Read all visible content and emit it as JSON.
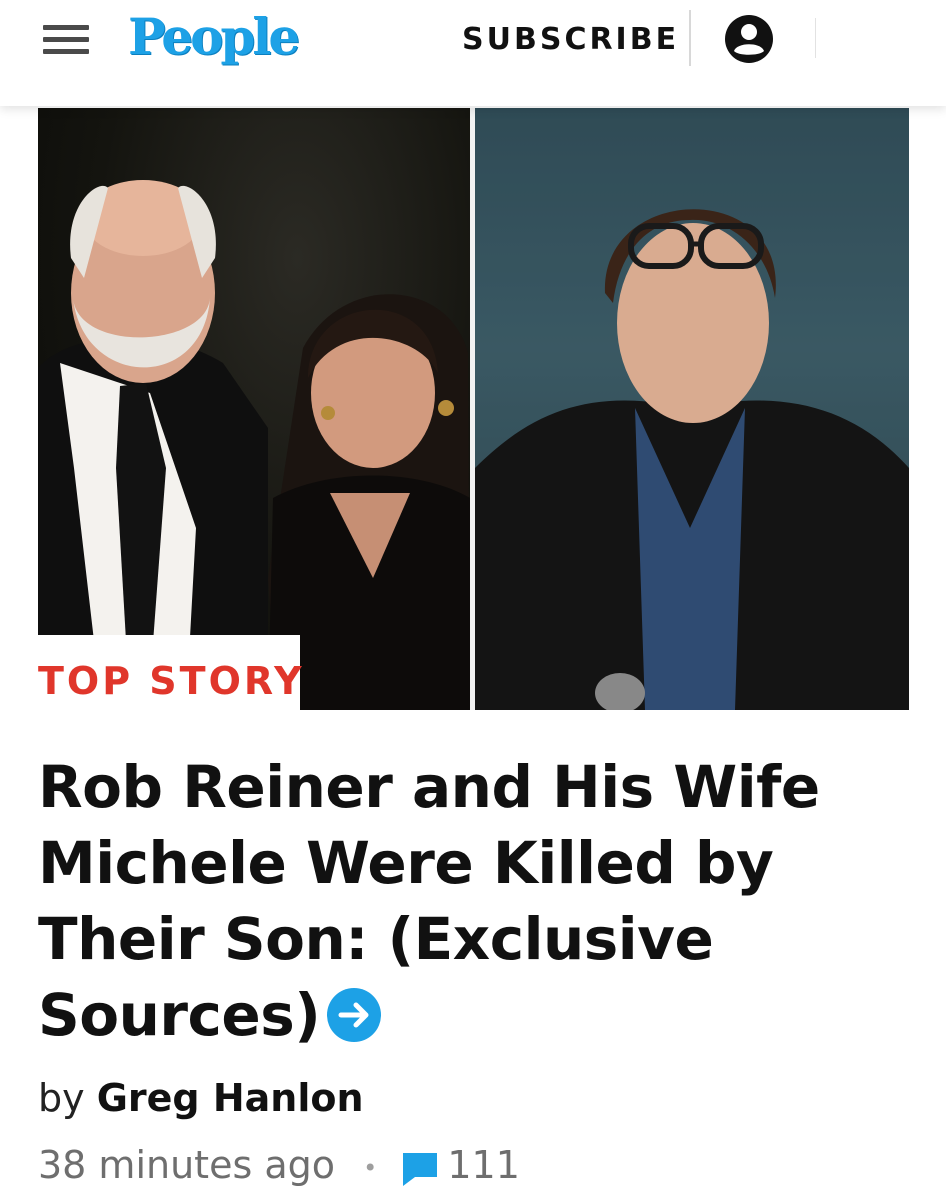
{
  "header": {
    "logo_text": "People",
    "subscribe_label": "SUBSCRIBE",
    "brand_color": "#1da1e6",
    "menu_icon": "hamburger-menu-icon",
    "account_icon": "account-circle-icon"
  },
  "hero": {
    "badge_label": "TOP STORY",
    "badge_color": "#e0362b"
  },
  "article": {
    "headline": "Rob Reiner and His Wife Michele Were Killed by Their Son: (Exclusive Sources)",
    "headline_icon": "arrow-right-circle-icon",
    "byline_prefix": "by",
    "author": "Greg Hanlon",
    "timestamp": "38 minutes ago",
    "comment_count": "111",
    "comment_icon": "comment-bubble-icon",
    "accent_color": "#1da1e6"
  }
}
